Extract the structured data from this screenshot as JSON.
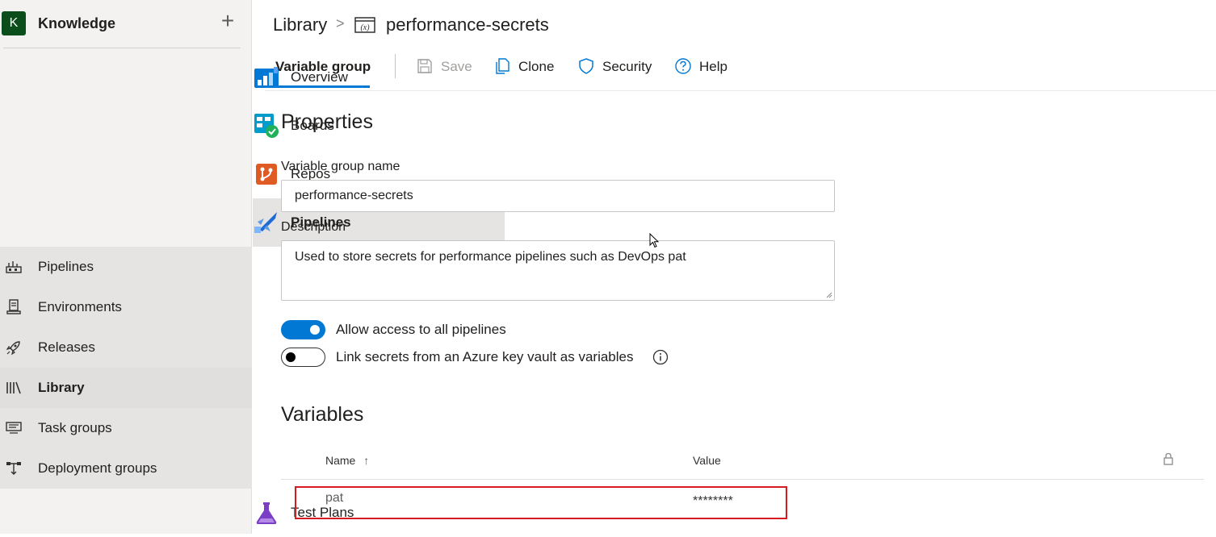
{
  "project": {
    "initial": "K",
    "name": "Knowledge",
    "add_icon": "plus-icon",
    "avatar_color": "#0b4e1c"
  },
  "nav": {
    "overview": "Overview",
    "boards": "Boards",
    "repos": "Repos",
    "pipelines_group": "Pipelines",
    "pipelines": "Pipelines",
    "environments": "Environments",
    "releases": "Releases",
    "library": "Library",
    "task_groups": "Task groups",
    "deployment_groups": "Deployment groups",
    "test_plans": "Test Plans"
  },
  "breadcrumb": {
    "root": "Library",
    "separator": ">",
    "current": "performance-secrets"
  },
  "toolbar": {
    "tab": "Variable group",
    "save": "Save",
    "clone": "Clone",
    "security": "Security",
    "help": "Help"
  },
  "properties": {
    "title": "Properties",
    "name_label": "Variable group name",
    "name_value": "performance-secrets",
    "description_label": "Description",
    "description_value": "Used to store secrets for performance pipelines such as DevOps pat",
    "allow_access_label": "Allow access to all pipelines",
    "allow_access_on": true,
    "link_keyvault_label": "Link secrets from an Azure key vault as variables",
    "link_keyvault_on": false
  },
  "variables": {
    "title": "Variables",
    "columns": {
      "name": "Name",
      "sort_arrow": "↑",
      "value": "Value",
      "lock_icon": "lock-icon"
    },
    "rows": [
      {
        "name": "pat",
        "value": "********"
      }
    ]
  },
  "colors": {
    "accent": "#0078d4",
    "highlight": "#d71920",
    "sidebar_bg": "#f3f2f1"
  }
}
